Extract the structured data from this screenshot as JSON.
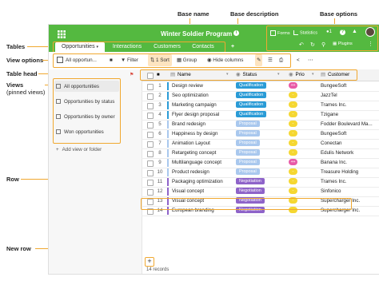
{
  "annotations": {
    "base_name": "Base name",
    "base_description": "Base description",
    "base_options": "Base options",
    "tables": "Tables",
    "view_options": "View options",
    "table_head": "Table head",
    "views": "Views",
    "views_sub": "(pinned views)",
    "row": "Row",
    "new_row": "New row"
  },
  "header": {
    "title": "Winter Soldier Program",
    "forms": "Forms",
    "statistics": "Statistics",
    "plugins": "Plugins"
  },
  "tabs": [
    "Opportunities",
    "Interactions",
    "Customers",
    "Contacts"
  ],
  "toolbar": {
    "view_name": "All opportun...",
    "filter": "Filter",
    "sort": "1 Sort",
    "group": "Group",
    "hide": "Hide columns"
  },
  "sidebar": {
    "views": [
      "All opportunities",
      "Opportunities by status",
      "Opportunities by owner",
      "Won opportunities"
    ],
    "add": "Add view or folder"
  },
  "columns": {
    "name": "Name",
    "status": "Status",
    "prio": "Prio",
    "customer": "Customer"
  },
  "rows": [
    {
      "n": "1",
      "name": "Design review",
      "status": "Qualification",
      "customer": "BungeeSoft"
    },
    {
      "n": "2",
      "name": "Seo optimization",
      "status": "Qualification",
      "customer": "JazzTel"
    },
    {
      "n": "3",
      "name": "Marketing campaign",
      "status": "Qualification",
      "customer": "Trames Inc."
    },
    {
      "n": "4",
      "name": "Flyer design proposal",
      "status": "Qualification",
      "customer": "Tzigane"
    },
    {
      "n": "5",
      "name": "Brand redesign",
      "status": "Proposal",
      "customer": "Fodder Boulevard Ma..."
    },
    {
      "n": "6",
      "name": "Happiness by design",
      "status": "Proposal",
      "customer": "BungeeSoft"
    },
    {
      "n": "7",
      "name": "Animation Layout",
      "status": "Proposal",
      "customer": "Conectan"
    },
    {
      "n": "8",
      "name": "Retargeting concept",
      "status": "Proposal",
      "customer": "Edulis Network"
    },
    {
      "n": "9",
      "name": "Multilanguage concept",
      "status": "Proposal",
      "customer": "Banana Inc."
    },
    {
      "n": "10",
      "name": "Product redesign",
      "status": "Proposal",
      "customer": "Treasure Holding"
    },
    {
      "n": "11",
      "name": "Packaging optimization",
      "status": "Negotiation",
      "customer": "Trames Inc."
    },
    {
      "n": "12",
      "name": "Visual concept",
      "status": "Negotiation",
      "customer": "Sinfonico"
    },
    {
      "n": "13",
      "name": "Visual concept",
      "status": "Negotiation",
      "customer": "Supercharger Inc."
    },
    {
      "n": "14",
      "name": "European branding",
      "status": "Negotiation",
      "customer": "Supercharger Inc."
    }
  ],
  "prio_labels": [
    "++",
    "-",
    "-",
    "-",
    "-",
    "-",
    "-",
    "-",
    "++",
    "-",
    "-",
    "-",
    "-",
    "-"
  ],
  "footer": {
    "records": "14 records",
    "add": "+"
  },
  "colors": {
    "brand": "#54b940",
    "qualification": "#2a9bd6",
    "proposal": "#a9c8ee",
    "negotiation": "#8e63c9",
    "prio_high": "#e85aa7",
    "prio_low": "#f5d731",
    "highlight": "#f0a830"
  }
}
